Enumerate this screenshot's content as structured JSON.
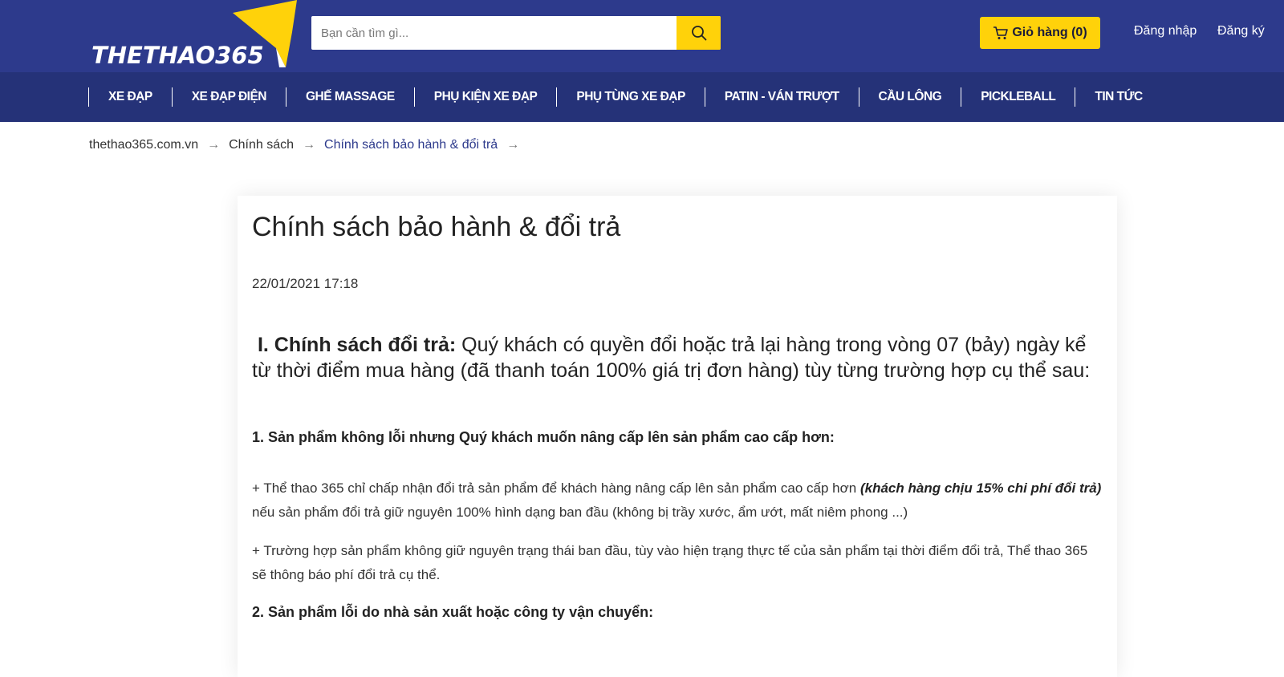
{
  "header": {
    "logo_text": "THETHAO365",
    "search_placeholder": "Bạn cần tìm gì...",
    "cart_label": "Giỏ hàng (0)",
    "login_label": "Đăng nhập",
    "register_label": "Đăng ký",
    "colors": {
      "brand_blue": "#2d3a8c",
      "nav_blue": "#253278",
      "accent_yellow": "#ffd20a"
    }
  },
  "nav": {
    "items": [
      "XE ĐẠP",
      "XE ĐẠP ĐIỆN",
      "GHẾ MASSAGE",
      "PHỤ KIỆN XE ĐẠP",
      "PHỤ TÙNG XE ĐẠP",
      "PATIN - VÁN TRƯỢT",
      "CẦU LÔNG",
      "PICKLEBALL",
      "TIN TỨC"
    ]
  },
  "breadcrumb": {
    "home": "thethao365.com.vn",
    "section": "Chính sách",
    "current": "Chính sách bảo hành & đổi trả",
    "separator": "→"
  },
  "article": {
    "title": "Chính sách bảo hành & đổi trả",
    "date": "22/01/2021 17:18",
    "lead_heading": "I. Chính sách đổi trả:",
    "lead_text": " Quý khách có quyền đổi hoặc trả lại hàng trong vòng 07 (bảy) ngày kể từ thời điểm mua hàng (đã thanh toán 100% giá trị đơn hàng) tùy từng trường hợp cụ thể sau:",
    "section1_heading": "1. Sản phẩm không lỗi nhưng Quý khách muốn nâng cấp lên sản phẩm cao cấp hơn:",
    "para1_start": "+ Thể thao 365 chỉ chấp nhận đổi trả sản phẩm để khách hàng nâng cấp lên sản phẩm cao cấp hơn ",
    "para1_emphasis": "(khách hàng chịu 15% chi phí đổi trả)",
    "para1_end": " nếu sản phẩm đổi trả giữ nguyên 100% hình dạng ban đầu (không bị trầy xước, ẩm ướt, mất niêm phong ...)",
    "para2": "+ Trường hợp sản phẩm không giữ nguyên trạng thái ban đầu, tùy vào hiện trạng thực tế của sản phẩm tại thời điểm đổi trả, Thể thao 365 sẽ thông báo phí đổi trả cụ thể.",
    "section2_heading": "2. Sản phẩm lỗi do nhà sản xuất hoặc công ty vận chuyển:"
  }
}
